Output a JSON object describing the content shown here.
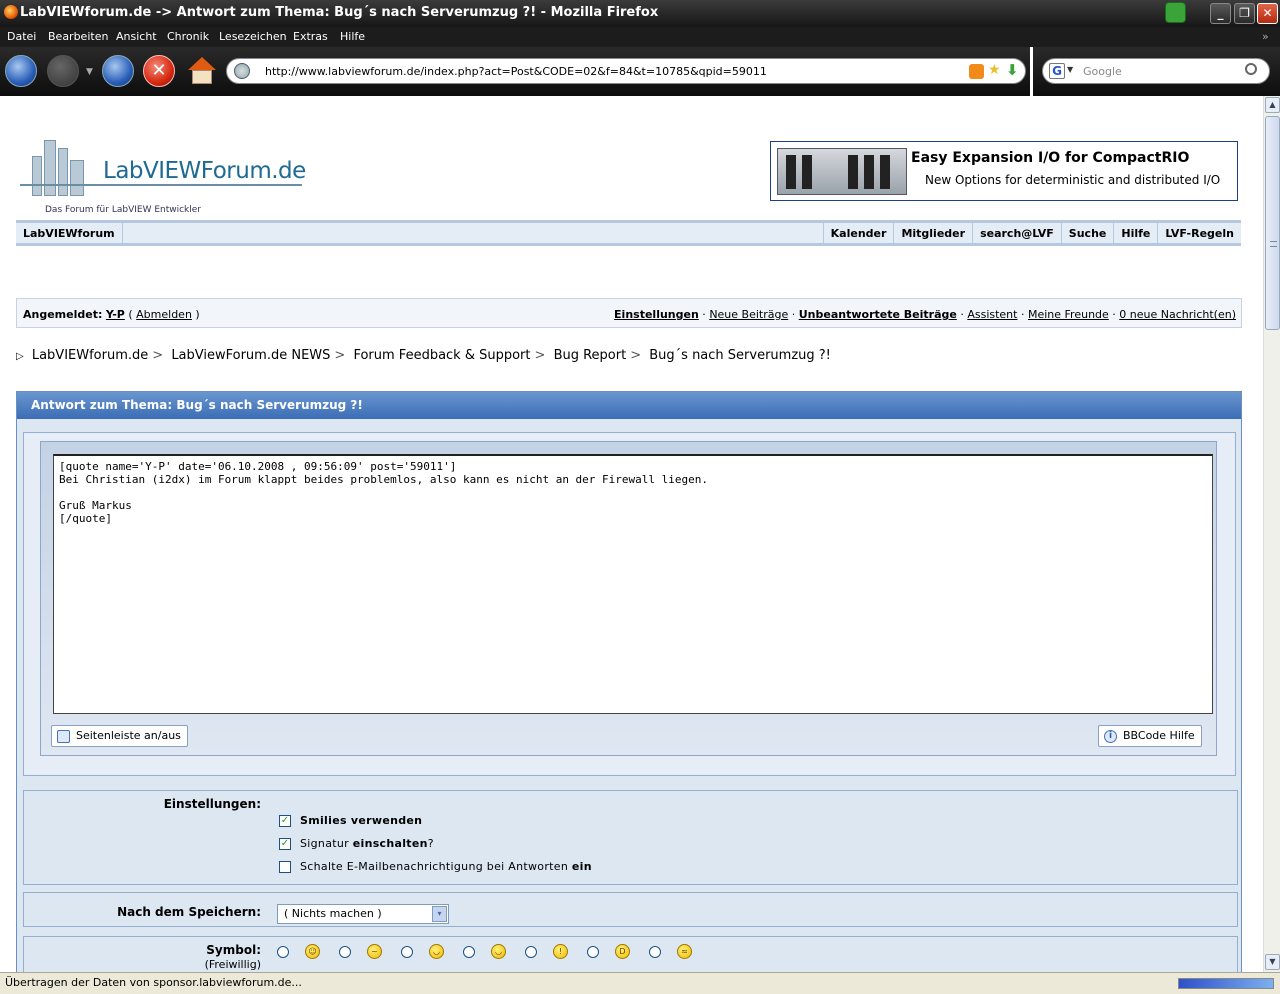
{
  "window": {
    "title": "LabVIEWforum.de -> Antwort zum Thema: Bug´s nach Serverumzug ?! - Mozilla Firefox",
    "minimize": "_",
    "maximize": "❐",
    "close": "✕"
  },
  "menu": [
    "Datei",
    "Bearbeiten",
    "Ansicht",
    "Chronik",
    "Lesezeichen",
    "Extras",
    "Hilfe"
  ],
  "menu_overflow": "»",
  "nav": {
    "url": "http://www.labviewforum.de/index.php?act=Post&CODE=02&f=84&t=10785&qpid=59011",
    "search_placeholder": "Google",
    "search_engine": "G",
    "stop_glyph": "✕"
  },
  "logo": {
    "name": "LabVIEWForum.de",
    "tagline": "Das Forum für LabVIEW Entwickler"
  },
  "ad": {
    "title": "Easy Expansion I/O for CompactRIO",
    "subtitle": "New Options for deterministic and distributed I/O"
  },
  "topnav": {
    "home": "LabVIEWforum",
    "items": [
      "Kalender",
      "Mitglieder",
      "search@LVF",
      "Suche",
      "Hilfe",
      "LVF-Regeln"
    ]
  },
  "userbar": {
    "logged_in_label": "Angemeldet:",
    "username": "Y-P",
    "logout": "Abmelden",
    "links": {
      "settings": "Einstellungen",
      "new_posts": "Neue Beiträge",
      "unanswered": "Unbeantwortete Beiträge",
      "assistant": "Assistent",
      "friends": "Meine Freunde",
      "messages": "0 neue Nachricht(en)"
    }
  },
  "breadcrumb": [
    "LabVIEWforum.de",
    "LabViewForum.de NEWS",
    "Forum Feedback & Support",
    "Bug Report",
    "Bug´s nach Serverumzug ?!"
  ],
  "breadcrumb_sep": ">",
  "breadcrumb_marker": "▷",
  "post": {
    "header": "Antwort zum Thema: Bug´s nach Serverumzug ?!",
    "text": "[quote name='Y-P' date='06.10.2008 , 09:56:09' post='59011']\nBei Christian (i2dx) im Forum klappt beides problemlos, also kann es nicht an der Firewall liegen.\n\nGruß Markus\n[/quote]",
    "sidebar_toggle": "Seitenleiste an/aus",
    "bbcode_help": "BBCode Hilfe",
    "bbcode_icon": "i"
  },
  "options": {
    "label": "Einstellungen:",
    "checkmark": "✓",
    "smilies_label": "Smilies verwenden",
    "smilies_checked": true,
    "signature_pre": "Signatur ",
    "signature_bold": "einschalten",
    "signature_post": "?",
    "signature_checked": true,
    "email_pre": "Schalte E-Mailbenachrichtigung bei Antworten ",
    "email_bold": "ein",
    "email_checked": false
  },
  "after_save": {
    "label": "Nach dem Speichern:",
    "selected": "( Nichts machen )",
    "dropdown_glyph": "▾"
  },
  "symbol": {
    "label": "Symbol:",
    "sublabel": "(Freiwillig)",
    "faces": [
      "☺",
      "~",
      "◡",
      "◡",
      "!",
      "D",
      "≈"
    ]
  },
  "scrollbar": {
    "up": "▲",
    "down": "▼"
  },
  "status": {
    "text": "Übertragen der Daten von sponsor.labviewforum.de...",
    "progress": 1.0
  }
}
